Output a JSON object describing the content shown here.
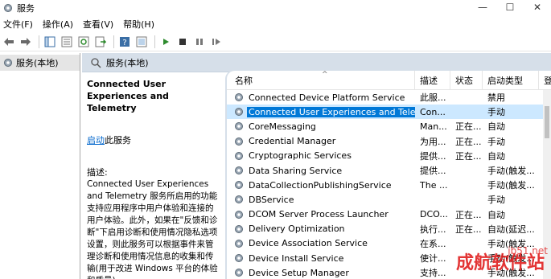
{
  "window": {
    "title": "服务",
    "minimize": "—",
    "maximize": "☐",
    "close": "✕"
  },
  "menu": {
    "items": [
      "文件(F)",
      "操作(A)",
      "查看(V)",
      "帮助(H)"
    ]
  },
  "tree": {
    "root_label": "服务(本地)"
  },
  "pane": {
    "header": "服务(本地)"
  },
  "details": {
    "service_title": "Connected User Experiences and Telemetry",
    "start_link": "启动",
    "start_suffix": "此服务",
    "desc_label": "描述:",
    "desc_text": "Connected User Experiences and Telemetry 服务所启用的功能支持应用程序中用户体验和连接的用户体验。此外，如果在\"反馈和诊断\"下启用诊断和使用情况隐私选项设置，则此服务可以根据事件来管理诊断和使用情况信息的收集和传输(用于改进 Windows 平台的体验和质量)。"
  },
  "columns": {
    "name": "名称",
    "description": "描述",
    "status": "状态",
    "startup": "启动类型",
    "logon": "登"
  },
  "services": [
    {
      "name": "Connected Device Platform Service",
      "description": "此服...",
      "status": "",
      "startup": "禁用",
      "logon": ""
    },
    {
      "name": "Connected User Experiences and Telem...",
      "description": "Con...",
      "status": "",
      "startup": "手动",
      "logon": ""
    },
    {
      "name": "CoreMessaging",
      "description": "Man...",
      "status": "正在...",
      "startup": "自动",
      "logon": ""
    },
    {
      "name": "Credential Manager",
      "description": "为用...",
      "status": "正在...",
      "startup": "手动",
      "logon": ""
    },
    {
      "name": "Cryptographic Services",
      "description": "提供...",
      "status": "正在...",
      "startup": "自动",
      "logon": ""
    },
    {
      "name": "Data Sharing Service",
      "description": "提供...",
      "status": "",
      "startup": "手动(触发...",
      "logon": ""
    },
    {
      "name": "DataCollectionPublishingService",
      "description": "The ...",
      "status": "",
      "startup": "手动(触发...",
      "logon": ""
    },
    {
      "name": "DBService",
      "description": "",
      "status": "",
      "startup": "手动",
      "logon": ""
    },
    {
      "name": "DCOM Server Process Launcher",
      "description": "DCO...",
      "status": "正在...",
      "startup": "自动",
      "logon": ""
    },
    {
      "name": "Delivery Optimization",
      "description": "执行...",
      "status": "正在...",
      "startup": "自动(延迟...",
      "logon": ""
    },
    {
      "name": "Device Association Service",
      "description": "在系...",
      "status": "",
      "startup": "手动(触发...",
      "logon": ""
    },
    {
      "name": "Device Install Service",
      "description": "使计...",
      "status": "",
      "startup": "手动(触发...",
      "logon": ""
    },
    {
      "name": "Device Setup Manager",
      "description": "支持...",
      "status": "",
      "startup": "手动(触发...",
      "logon": ""
    }
  ],
  "selected_index": 1,
  "watermark": {
    "main": "成航软件站",
    "sub": "jb51.net"
  }
}
